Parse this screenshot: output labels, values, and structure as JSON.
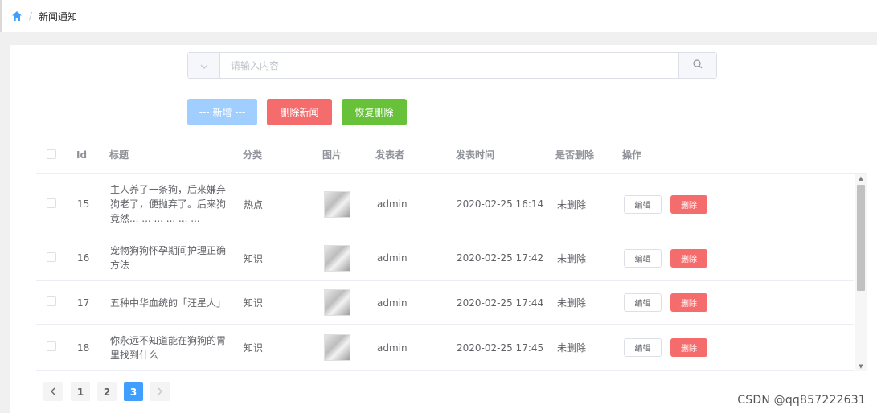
{
  "breadcrumb": {
    "current": "新闻通知"
  },
  "search": {
    "placeholder": "请输入内容",
    "value": ""
  },
  "toolbar": {
    "add_label": "--- 新增 ---",
    "delete_news_label": "删除新闻",
    "restore_label": "恢复删除"
  },
  "table": {
    "headers": {
      "id": "Id",
      "title": "标题",
      "category": "分类",
      "image": "图片",
      "author": "发表者",
      "time": "发表时间",
      "deleted": "是否删除",
      "ops": "操作"
    },
    "edit_label": "编辑",
    "delete_label": "删除",
    "rows": [
      {
        "id": "15",
        "title_lines": [
          "主人养了一条狗，后来嫌弃",
          "狗老了，便抛弃了。后来狗",
          "竟然... ... ... ... ... ..."
        ],
        "category": "热点",
        "author": "admin",
        "time": "2020-02-25 16:14",
        "deleted": "未删除"
      },
      {
        "id": "16",
        "title_lines": [
          "宠物狗狗怀孕期间护理正确",
          "方法"
        ],
        "category": "知识",
        "author": "admin",
        "time": "2020-02-25 17:42",
        "deleted": "未删除"
      },
      {
        "id": "17",
        "title_lines": [
          "五种中华血统的「汪星人」"
        ],
        "category": "知识",
        "author": "admin",
        "time": "2020-02-25 17:44",
        "deleted": "未删除"
      },
      {
        "id": "18",
        "title_lines": [
          "你永远不知道能在狗狗的胃",
          "里找到什么"
        ],
        "category": "知识",
        "author": "admin",
        "time": "2020-02-25 17:45",
        "deleted": "未删除"
      }
    ]
  },
  "pagination": {
    "pages": [
      "1",
      "2",
      "3"
    ],
    "current": "3",
    "prev_icon": "chevron-left-icon",
    "next_icon": "chevron-right-icon"
  },
  "watermark": "CSDN @qq857222631",
  "colors": {
    "primary": "#409eff",
    "primary_light": "#a0cfff",
    "danger": "#f56c6c",
    "success": "#67c23a"
  }
}
